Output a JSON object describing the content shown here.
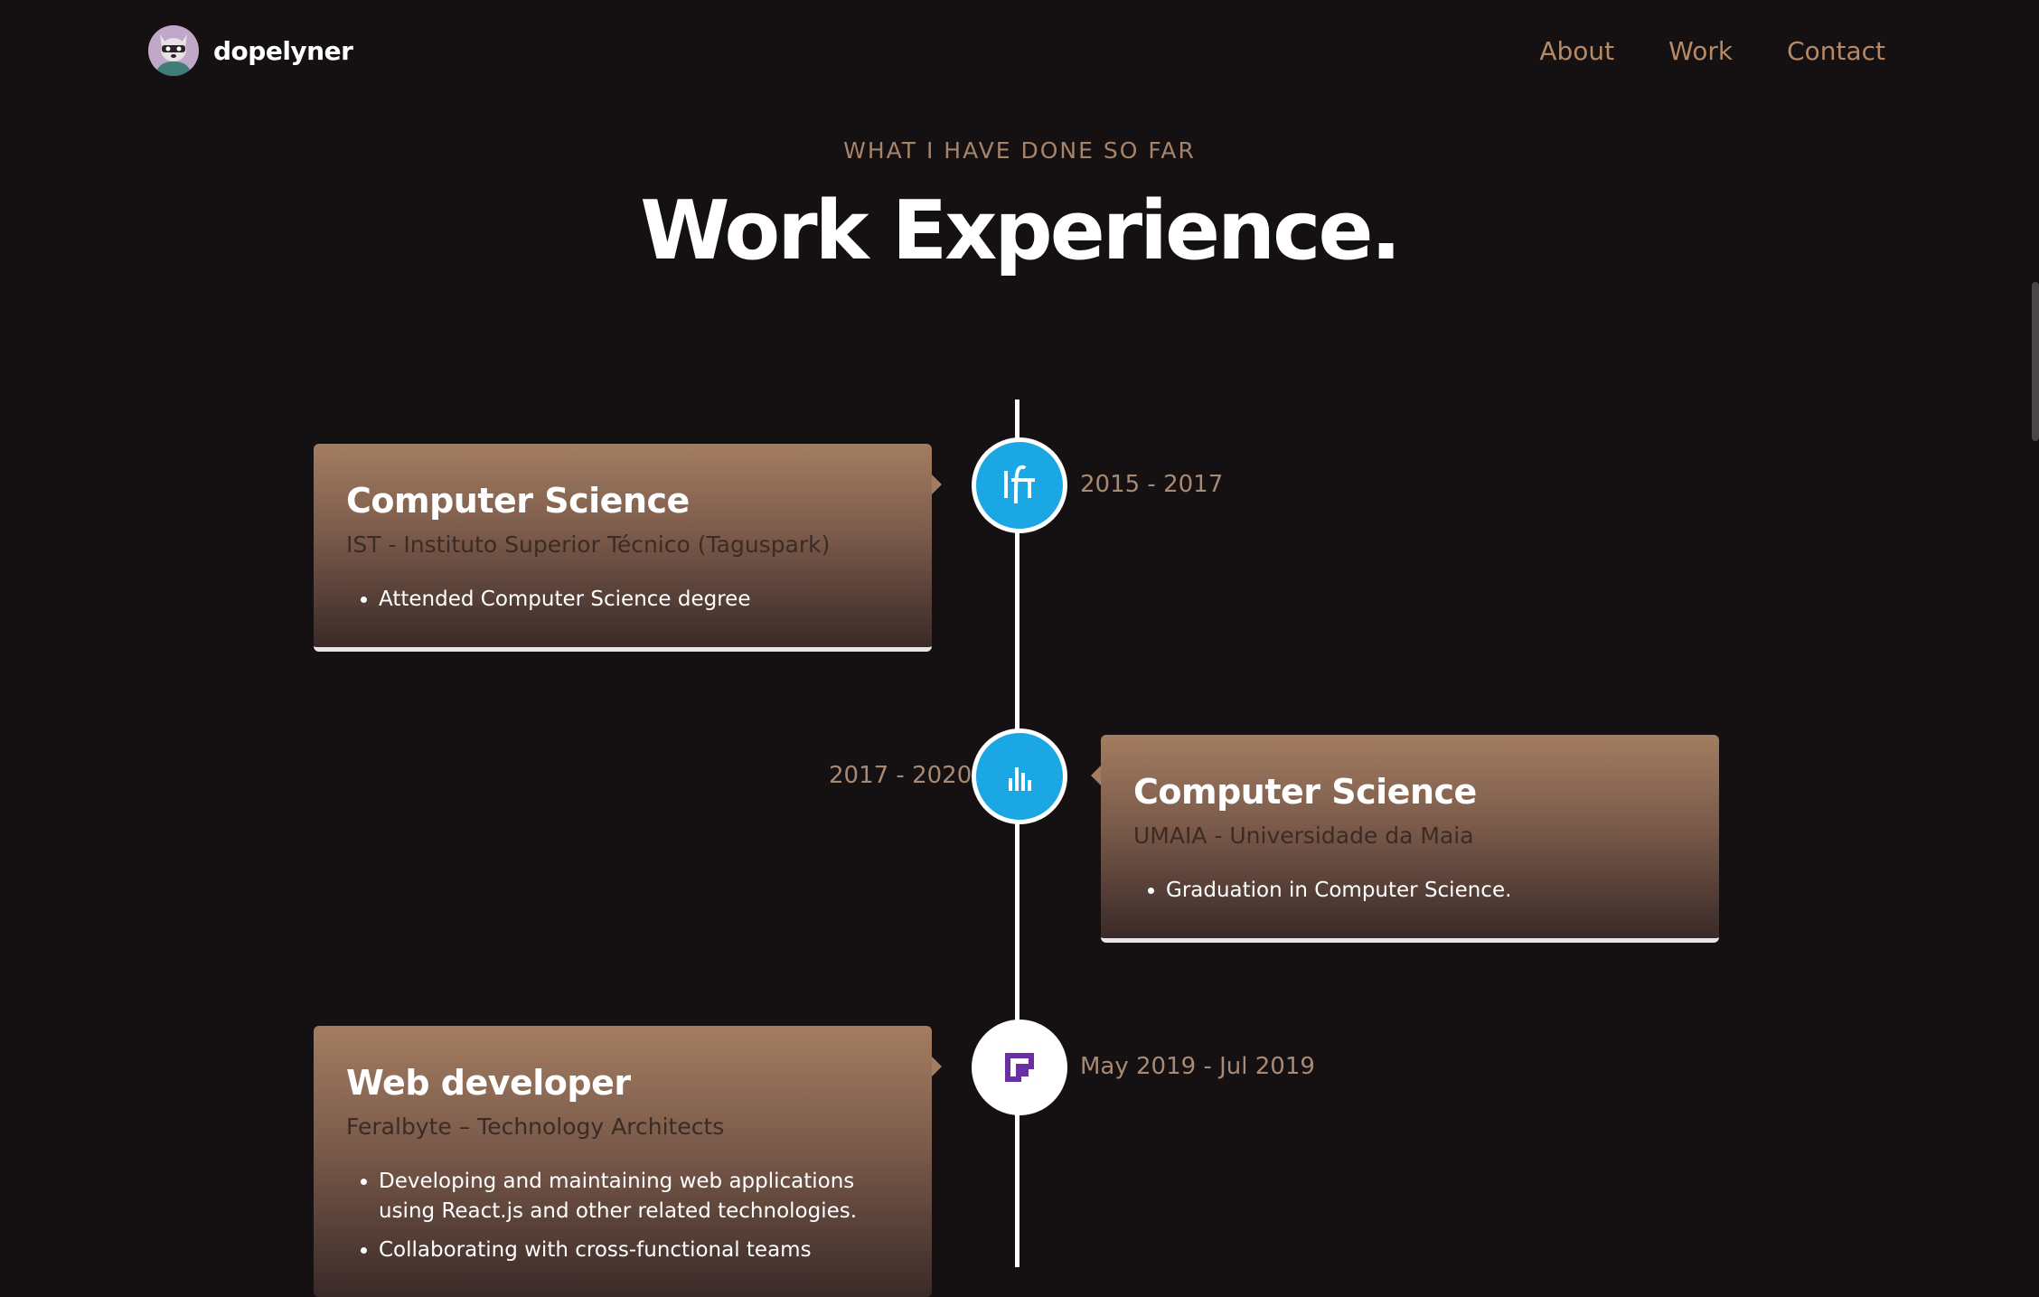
{
  "brand": {
    "name": "dopelyner",
    "avatar_icon": "raccoon-avatar-icon"
  },
  "nav": {
    "links": [
      "About",
      "Work",
      "Contact"
    ]
  },
  "section": {
    "subtitle": "WHAT I HAVE DONE SO FAR",
    "title": "Work Experience."
  },
  "colors": {
    "background": "#151011",
    "accent": "#b78965",
    "node_blue": "#1ba6e4",
    "card_top": "#a37d61",
    "card_bottom": "#3a2a28"
  },
  "experiences": [
    {
      "title": "Computer Science",
      "org": "IST - Instituto Superior Técnico (Taguspark)",
      "date": "2015 - 2017",
      "icon": "ist-logo-icon",
      "points": [
        "Attended Computer Science degree"
      ]
    },
    {
      "title": "Computer Science",
      "org": "UMAIA - Universidade da Maia",
      "date": "2017 - 2020",
      "icon": "umaia-logo-icon",
      "points": [
        "Graduation in Computer Science."
      ]
    },
    {
      "title": "Web developer",
      "org": "Feralbyte – Technology Architects",
      "date": "May 2019 - Jul 2019",
      "icon": "feralbyte-logo-icon",
      "points": [
        "Developing and maintaining web applications using React.js and other related technologies.",
        "Collaborating with cross-functional teams"
      ]
    }
  ]
}
